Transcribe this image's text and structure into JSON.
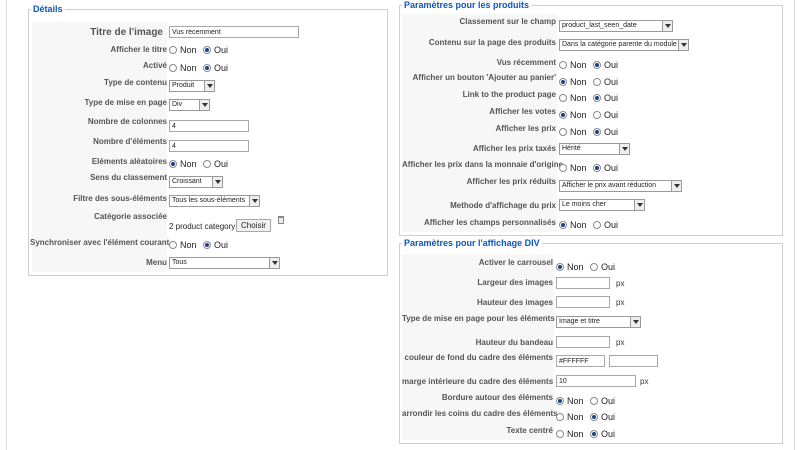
{
  "details": {
    "legend": "Détails",
    "title_label": "Titre de l'image",
    "title_value": "Vus récemment",
    "show_title_label": "Afficher le titre",
    "active_label": "Activé",
    "content_type_label": "Type de contenu",
    "content_type_value": "Produit",
    "layout_label": "Type de mise en page",
    "layout_value": "Div",
    "columns_label": "Nombre de colonnes",
    "columns_value": "4",
    "items_label": "Nombre d'éléments",
    "items_value": "4",
    "random_label": "Eléments aléatoires",
    "sort_label": "Sens du classement",
    "sort_value": "Croissant",
    "subfilter_label": "Filtre des sous-éléments",
    "subfilter_value": "Tous les sous-éléments",
    "category_label": "Catégorie associée",
    "category_value": "2 product category",
    "choose_label": "Choisir",
    "sync_label": "Synchroniser avec l'élément courant",
    "menu_label": "Menu",
    "menu_value": "Tous"
  },
  "products": {
    "legend": "Paramètres pour les produits",
    "ranking_label": "Classement sur le champ",
    "ranking_value": "product_last_seen_date",
    "content_label": "Contenu sur la page des produits",
    "content_value": "Dans la catégorie parente du module",
    "recent_label": "Vus récemment",
    "add_cart_label": "Afficher un bouton 'Ajouter au panier'",
    "link_label": "Link to the product page",
    "votes_label": "Afficher les votes",
    "prices_label": "Afficher les prix",
    "taxed_label": "Afficher les prix taxés",
    "taxed_value": "Hérité",
    "currency_label": "Afficher les prix dans la monnaie d'origine",
    "reduced_label": "Afficher les prix réduits",
    "reduced_value": "Afficher le prix avant réduction",
    "method_label": "Methode d'affichage du prix",
    "method_value": "Le moins cher",
    "custom_label": "Afficher les champs personnalisés"
  },
  "div": {
    "legend": "Paramètres pour l'affichage DIV",
    "carousel_label": "Activer le carrousel",
    "img_width_label": "Largeur des images",
    "img_height_label": "Hauteur des images",
    "layout_label": "Type de mise en page pour les éléments",
    "layout_value": "Image et titre",
    "banner_label": "Hauteur du bandeau",
    "bgcolor_label": "couleur de fond du cadre des éléments",
    "bgcolor_value": "#FFFFFF",
    "padding_label": "marge intérieure du cadre des éléments",
    "padding_value": "10",
    "border_label": "Bordure autour des éléments",
    "rounded_label": "arrondir les coins du cadre des éléments",
    "center_label": "Texte centré"
  },
  "common": {
    "no": "Non",
    "yes": "Oui",
    "px": "px"
  }
}
